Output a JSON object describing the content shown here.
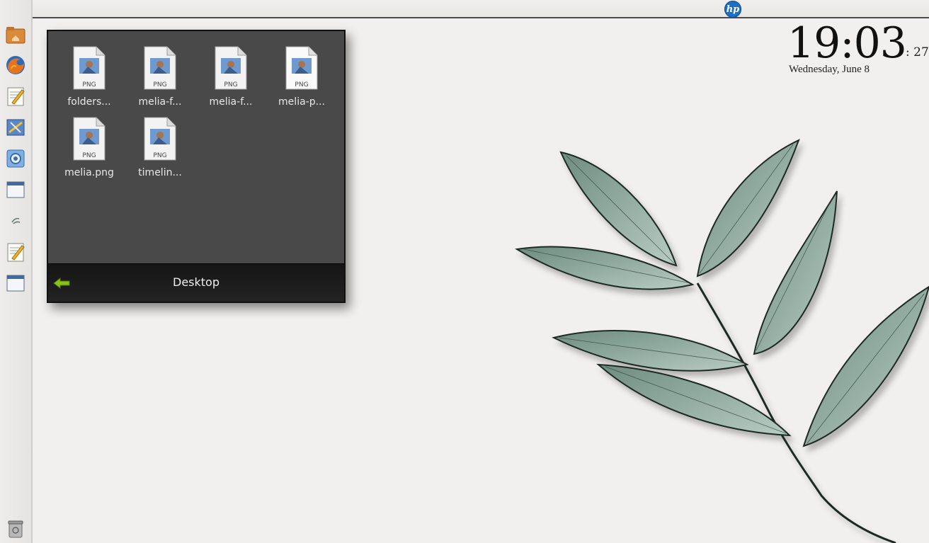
{
  "dock": {
    "items": [
      {
        "name": "home-folder",
        "icon": "folder-home-icon"
      },
      {
        "name": "firefox",
        "icon": "firefox-icon"
      },
      {
        "name": "text-editor",
        "icon": "text-editor-icon"
      },
      {
        "name": "drawing-app",
        "icon": "drawing-app-icon"
      },
      {
        "name": "chromium",
        "icon": "chromium-icon"
      },
      {
        "name": "window",
        "icon": "window-icon"
      },
      {
        "name": "small-app",
        "icon": "leaf-small-icon"
      },
      {
        "name": "text-editor-2",
        "icon": "text-editor-icon"
      },
      {
        "name": "window-2",
        "icon": "window-icon"
      }
    ],
    "trash": {
      "icon": "trash-icon"
    }
  },
  "topbar": {
    "logo": "hp"
  },
  "clock": {
    "time": "19:03",
    "seconds": ": 27",
    "date": "Wednesday, June 8"
  },
  "stack": {
    "title": "Desktop",
    "files": [
      {
        "label": "folders...",
        "type": "PNG"
      },
      {
        "label": "melia-f...",
        "type": "PNG"
      },
      {
        "label": "melia-f...",
        "type": "PNG"
      },
      {
        "label": "melia-p...",
        "type": "PNG"
      },
      {
        "label": "melia.png",
        "type": "PNG"
      },
      {
        "label": "timelin...",
        "type": "PNG"
      }
    ]
  },
  "colors": {
    "accent": "#8bc21a",
    "stack_bg": "#494949",
    "desktop_bg": "#f2f0ee",
    "leaf": "#9db5ab"
  }
}
